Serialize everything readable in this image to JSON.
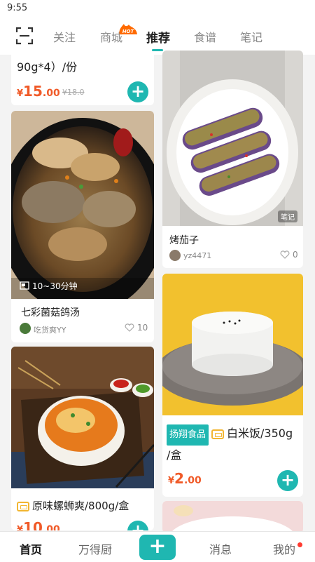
{
  "status": {
    "time": "9:55"
  },
  "top_tabs": [
    {
      "label": "关注"
    },
    {
      "label": "商城",
      "badge": "HOT"
    },
    {
      "label": "推荐"
    },
    {
      "label": "食谱"
    },
    {
      "label": "笔记"
    }
  ],
  "feed": {
    "card1": {
      "title": "90g*4）/份",
      "price_symbol": "¥",
      "price_int": "15",
      "price_dec": ".00",
      "old_price": "¥18.0",
      "add": "+"
    },
    "card2": {
      "duration": "10~30分钟",
      "title": "七彩菌菇鸽汤",
      "author": "吃货爽YY",
      "likes": "10"
    },
    "card3": {
      "title": "原味螺蛳爽/800g/盒",
      "price_symbol": "¥",
      "price_int": "10",
      "price_dec": ".00",
      "add": "+"
    },
    "card4": {
      "tag": "笔记",
      "title": "烤茄子",
      "author": "yz4471",
      "likes": "0"
    },
    "card5": {
      "brand": "扬翔食品",
      "title_line1": "白米饭/350g",
      "title_line2": "/盒",
      "price_symbol": "¥",
      "price_int": "2",
      "price_dec": ".00",
      "add": "+"
    }
  },
  "bottom_nav": {
    "home": "首页",
    "kitchen": "万得厨",
    "add": "+",
    "messages": "消息",
    "me": "我的"
  },
  "colors": {
    "accent": "#1fb7b1",
    "price": "#f05a28",
    "hot": "#ff6a00"
  }
}
